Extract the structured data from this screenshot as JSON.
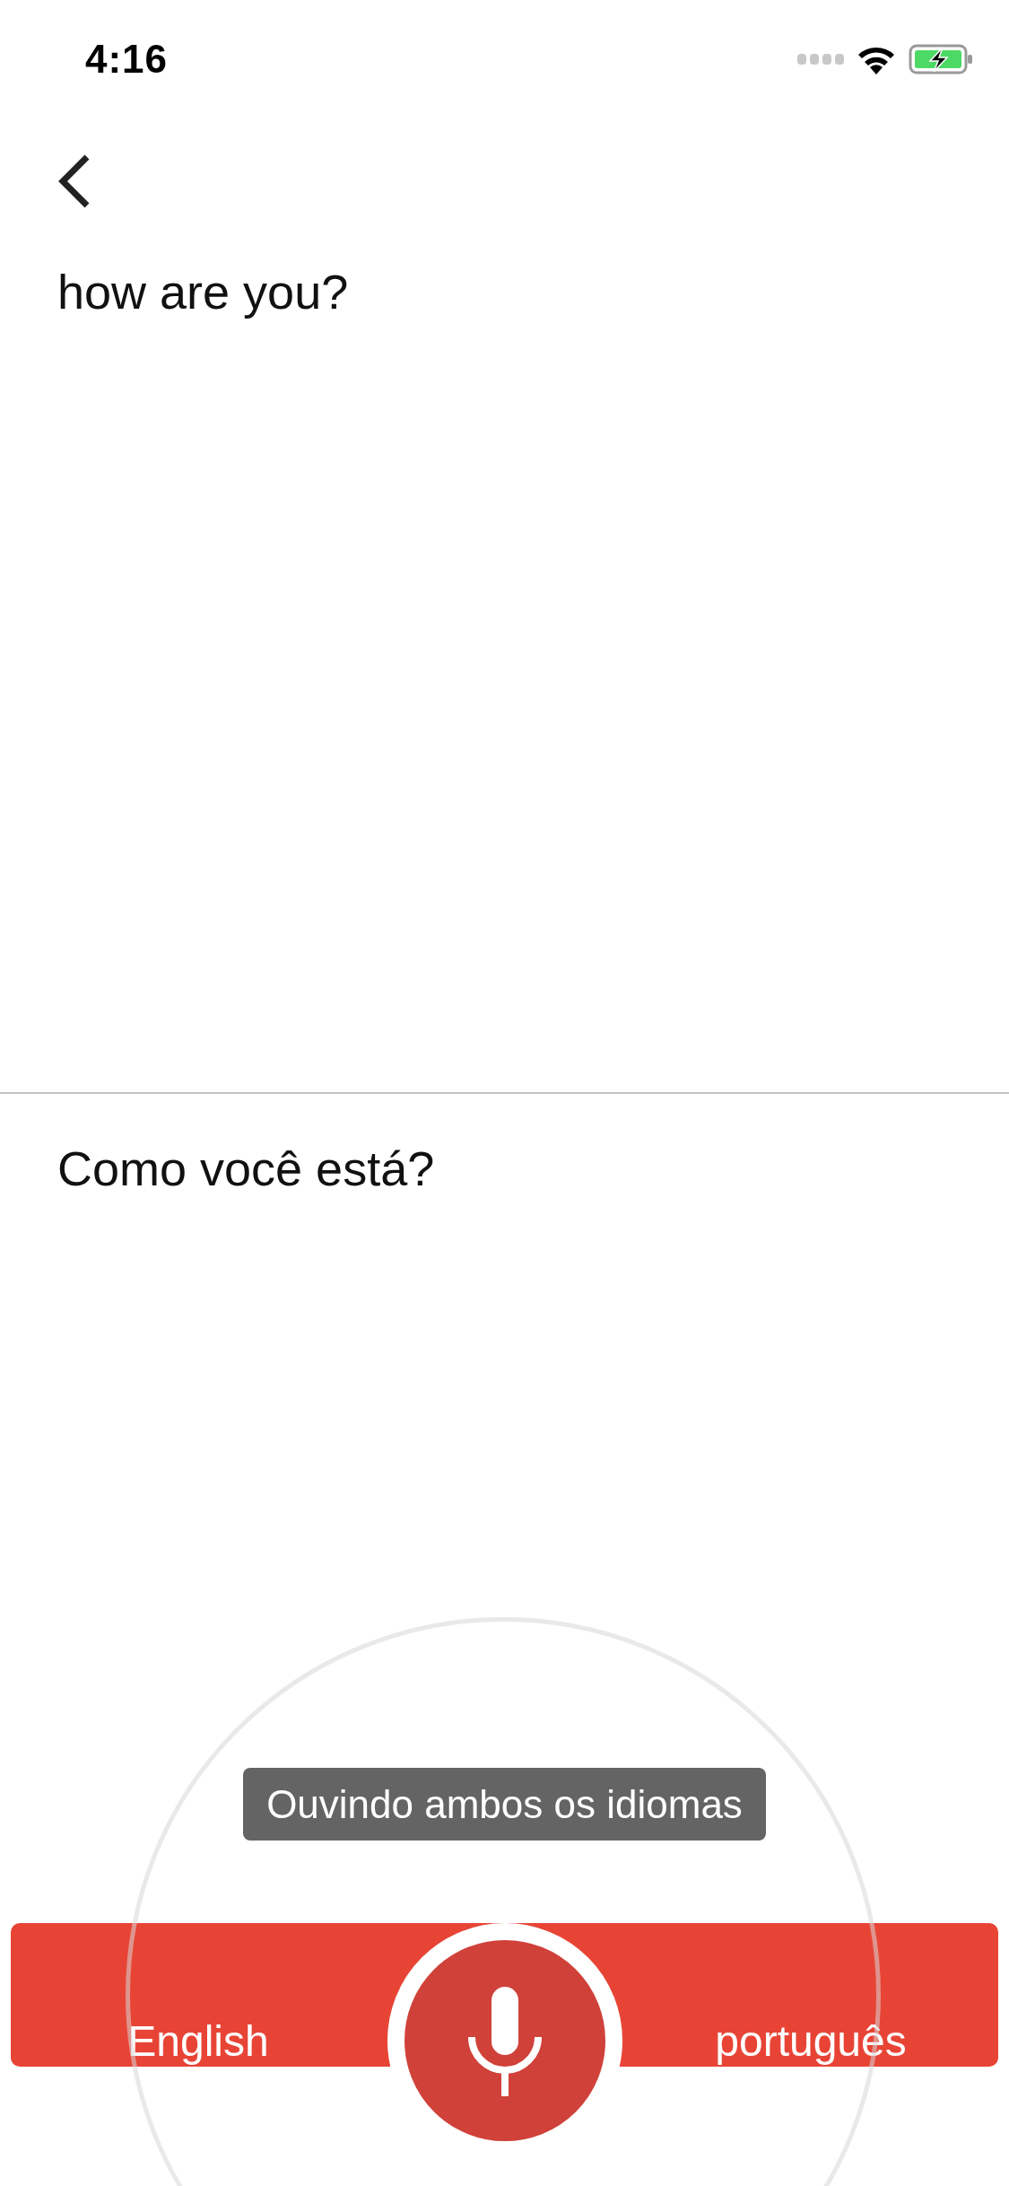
{
  "status_bar": {
    "time": "4:16"
  },
  "source": {
    "text": "how are you?"
  },
  "translation": {
    "text": "Como você está?"
  },
  "status_message": "Ouvindo ambos os idiomas",
  "languages": [
    {
      "label": "English"
    },
    {
      "label": "português"
    }
  ],
  "mic": {
    "listening": true
  }
}
